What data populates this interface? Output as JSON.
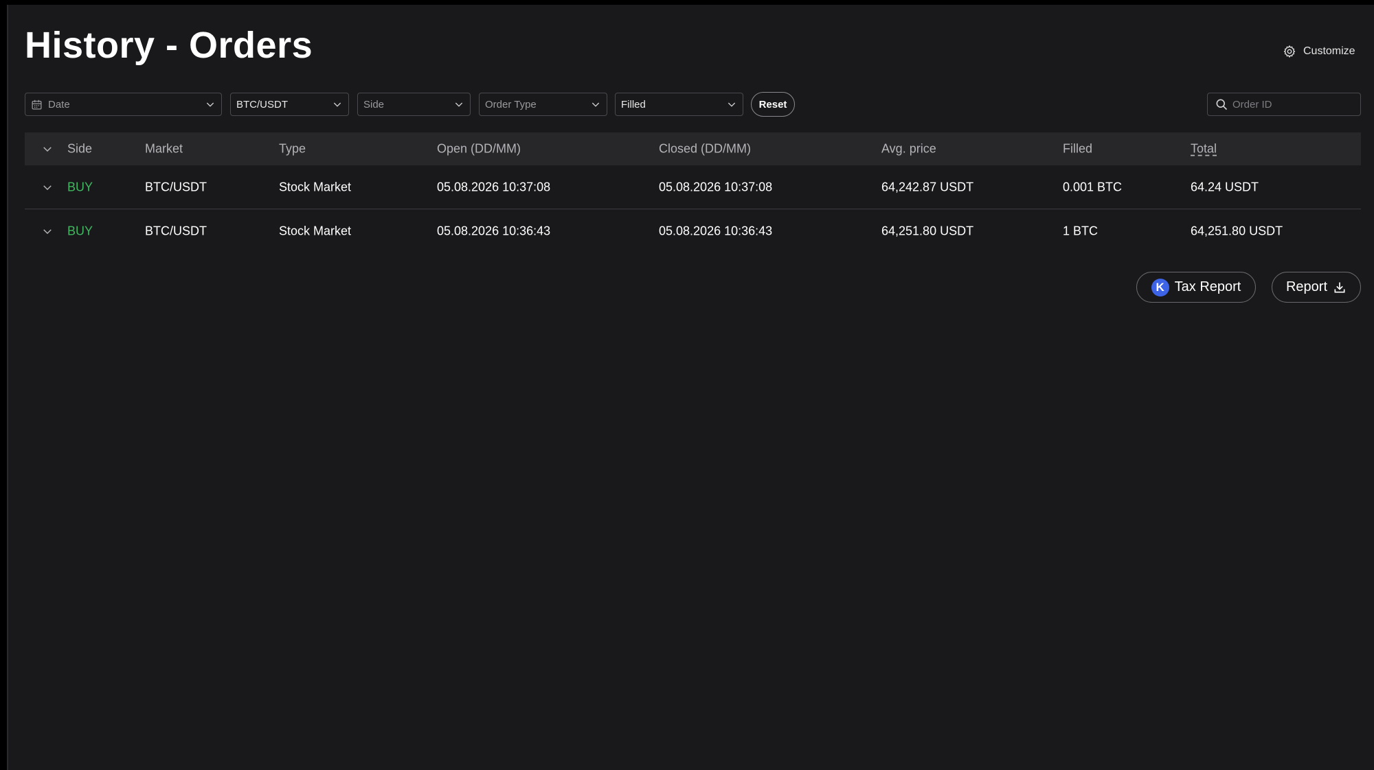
{
  "header": {
    "title": "History - Orders",
    "customize_label": "Customize"
  },
  "filters": {
    "date_placeholder": "Date",
    "market_value": "BTC/USDT",
    "side_placeholder": "Side",
    "order_type_placeholder": "Order Type",
    "status_value": "Filled",
    "reset_label": "Reset",
    "order_id_placeholder": "Order ID"
  },
  "table": {
    "columns": [
      "Side",
      "Market",
      "Type",
      "Open (DD/MM)",
      "Closed (DD/MM)",
      "Avg. price",
      "Filled",
      "Total"
    ],
    "rows": [
      {
        "side": "BUY",
        "market": "BTC/USDT",
        "type": "Stock Market",
        "open": "05.08.2026 10:37:08",
        "closed": "05.08.2026 10:37:08",
        "avg_price": "64,242.87 USDT",
        "filled": "0.001 BTC",
        "total": "64.24 USDT"
      },
      {
        "side": "BUY",
        "market": "BTC/USDT",
        "type": "Stock Market",
        "open": "05.08.2026 10:36:43",
        "closed": "05.08.2026 10:36:43",
        "avg_price": "64,251.80 USDT",
        "filled": "1 BTC",
        "total": "64,251.80 USDT"
      }
    ]
  },
  "actions": {
    "tax_logo_letter": "K",
    "tax_report_label": "Tax Report",
    "report_label": "Report"
  },
  "colors": {
    "background": "#19191b",
    "header_row": "#27272a",
    "buy": "#3fb860",
    "tax_logo": "#3d63e6"
  },
  "icons": {
    "customize": "gear-icon",
    "date": "calendar-icon",
    "dropdown": "chevron-down-icon",
    "search": "search-icon",
    "expand": "chevron-down-icon",
    "report": "download-icon"
  }
}
